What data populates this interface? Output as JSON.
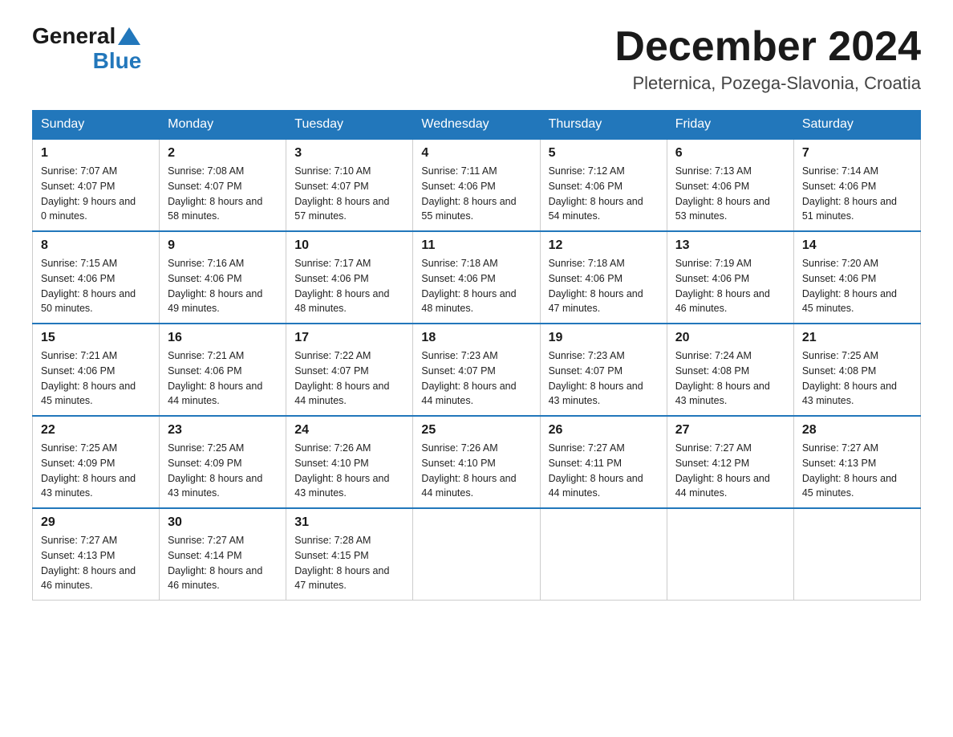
{
  "header": {
    "logo_general": "General",
    "logo_blue": "Blue",
    "main_title": "December 2024",
    "subtitle": "Pleternica, Pozega-Slavonia, Croatia"
  },
  "calendar": {
    "days_of_week": [
      "Sunday",
      "Monday",
      "Tuesday",
      "Wednesday",
      "Thursday",
      "Friday",
      "Saturday"
    ],
    "weeks": [
      [
        {
          "day": "1",
          "sunrise": "7:07 AM",
          "sunset": "4:07 PM",
          "daylight": "9 hours and 0 minutes."
        },
        {
          "day": "2",
          "sunrise": "7:08 AM",
          "sunset": "4:07 PM",
          "daylight": "8 hours and 58 minutes."
        },
        {
          "day": "3",
          "sunrise": "7:10 AM",
          "sunset": "4:07 PM",
          "daylight": "8 hours and 57 minutes."
        },
        {
          "day": "4",
          "sunrise": "7:11 AM",
          "sunset": "4:06 PM",
          "daylight": "8 hours and 55 minutes."
        },
        {
          "day": "5",
          "sunrise": "7:12 AM",
          "sunset": "4:06 PM",
          "daylight": "8 hours and 54 minutes."
        },
        {
          "day": "6",
          "sunrise": "7:13 AM",
          "sunset": "4:06 PM",
          "daylight": "8 hours and 53 minutes."
        },
        {
          "day": "7",
          "sunrise": "7:14 AM",
          "sunset": "4:06 PM",
          "daylight": "8 hours and 51 minutes."
        }
      ],
      [
        {
          "day": "8",
          "sunrise": "7:15 AM",
          "sunset": "4:06 PM",
          "daylight": "8 hours and 50 minutes."
        },
        {
          "day": "9",
          "sunrise": "7:16 AM",
          "sunset": "4:06 PM",
          "daylight": "8 hours and 49 minutes."
        },
        {
          "day": "10",
          "sunrise": "7:17 AM",
          "sunset": "4:06 PM",
          "daylight": "8 hours and 48 minutes."
        },
        {
          "day": "11",
          "sunrise": "7:18 AM",
          "sunset": "4:06 PM",
          "daylight": "8 hours and 48 minutes."
        },
        {
          "day": "12",
          "sunrise": "7:18 AM",
          "sunset": "4:06 PM",
          "daylight": "8 hours and 47 minutes."
        },
        {
          "day": "13",
          "sunrise": "7:19 AM",
          "sunset": "4:06 PM",
          "daylight": "8 hours and 46 minutes."
        },
        {
          "day": "14",
          "sunrise": "7:20 AM",
          "sunset": "4:06 PM",
          "daylight": "8 hours and 45 minutes."
        }
      ],
      [
        {
          "day": "15",
          "sunrise": "7:21 AM",
          "sunset": "4:06 PM",
          "daylight": "8 hours and 45 minutes."
        },
        {
          "day": "16",
          "sunrise": "7:21 AM",
          "sunset": "4:06 PM",
          "daylight": "8 hours and 44 minutes."
        },
        {
          "day": "17",
          "sunrise": "7:22 AM",
          "sunset": "4:07 PM",
          "daylight": "8 hours and 44 minutes."
        },
        {
          "day": "18",
          "sunrise": "7:23 AM",
          "sunset": "4:07 PM",
          "daylight": "8 hours and 44 minutes."
        },
        {
          "day": "19",
          "sunrise": "7:23 AM",
          "sunset": "4:07 PM",
          "daylight": "8 hours and 43 minutes."
        },
        {
          "day": "20",
          "sunrise": "7:24 AM",
          "sunset": "4:08 PM",
          "daylight": "8 hours and 43 minutes."
        },
        {
          "day": "21",
          "sunrise": "7:25 AM",
          "sunset": "4:08 PM",
          "daylight": "8 hours and 43 minutes."
        }
      ],
      [
        {
          "day": "22",
          "sunrise": "7:25 AM",
          "sunset": "4:09 PM",
          "daylight": "8 hours and 43 minutes."
        },
        {
          "day": "23",
          "sunrise": "7:25 AM",
          "sunset": "4:09 PM",
          "daylight": "8 hours and 43 minutes."
        },
        {
          "day": "24",
          "sunrise": "7:26 AM",
          "sunset": "4:10 PM",
          "daylight": "8 hours and 43 minutes."
        },
        {
          "day": "25",
          "sunrise": "7:26 AM",
          "sunset": "4:10 PM",
          "daylight": "8 hours and 44 minutes."
        },
        {
          "day": "26",
          "sunrise": "7:27 AM",
          "sunset": "4:11 PM",
          "daylight": "8 hours and 44 minutes."
        },
        {
          "day": "27",
          "sunrise": "7:27 AM",
          "sunset": "4:12 PM",
          "daylight": "8 hours and 44 minutes."
        },
        {
          "day": "28",
          "sunrise": "7:27 AM",
          "sunset": "4:13 PM",
          "daylight": "8 hours and 45 minutes."
        }
      ],
      [
        {
          "day": "29",
          "sunrise": "7:27 AM",
          "sunset": "4:13 PM",
          "daylight": "8 hours and 46 minutes."
        },
        {
          "day": "30",
          "sunrise": "7:27 AM",
          "sunset": "4:14 PM",
          "daylight": "8 hours and 46 minutes."
        },
        {
          "day": "31",
          "sunrise": "7:28 AM",
          "sunset": "4:15 PM",
          "daylight": "8 hours and 47 minutes."
        },
        null,
        null,
        null,
        null
      ]
    ]
  }
}
